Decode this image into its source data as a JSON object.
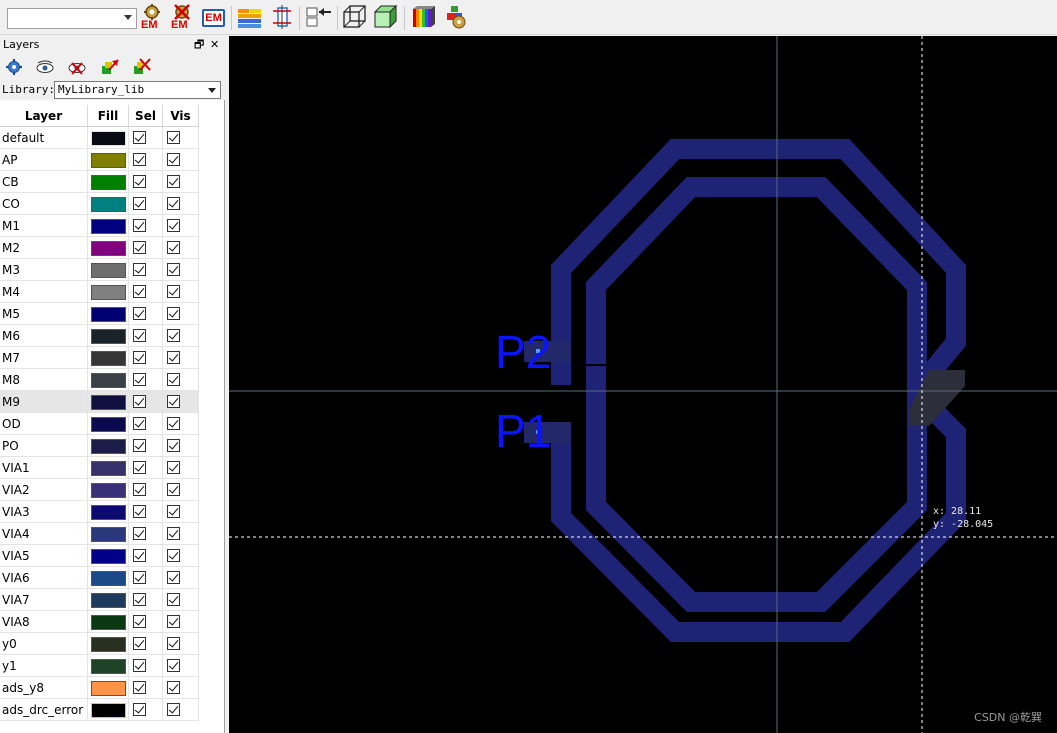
{
  "toolbar": {
    "combo_value": "",
    "buttons": [
      {
        "name": "em-setup-icon",
        "label": "EM"
      },
      {
        "name": "em-clear-icon",
        "label": "EM"
      },
      {
        "name": "em-icon",
        "label": "EM"
      },
      {
        "name": "layer-stack-icon"
      },
      {
        "name": "align-icon"
      },
      {
        "name": "port-arrow-icon"
      },
      {
        "name": "wireframe-view-icon"
      },
      {
        "name": "solid-view-icon"
      },
      {
        "name": "color-map-icon"
      },
      {
        "name": "component-icon"
      }
    ]
  },
  "layers_panel": {
    "title": "Layers",
    "float_glyph": "🗗",
    "close_glyph": "✕",
    "library_label": "Library:",
    "library_value": "MyLibrary_lib",
    "columns": [
      "Layer",
      "Fill",
      "Sel",
      "Vis"
    ],
    "rows": [
      {
        "name": "default",
        "fill": "#0a0a14",
        "border": "#e0e0e0"
      },
      {
        "name": "AP",
        "fill": "#808000"
      },
      {
        "name": "CB",
        "fill": "#008000"
      },
      {
        "name": "CO",
        "fill": "#008080"
      },
      {
        "name": "M1",
        "fill": "#000080"
      },
      {
        "name": "M2",
        "fill": "#800080"
      },
      {
        "name": "M3",
        "fill": "#6e6e6e"
      },
      {
        "name": "M4",
        "fill": "#808080"
      },
      {
        "name": "M5",
        "fill": "#000070"
      },
      {
        "name": "M6",
        "fill": "#1a2428"
      },
      {
        "name": "M7",
        "fill": "#363636"
      },
      {
        "name": "M8",
        "fill": "#3a4048"
      },
      {
        "name": "M9",
        "fill": "#101040",
        "highlight": true
      },
      {
        "name": "OD",
        "fill": "#0a0a50"
      },
      {
        "name": "PO",
        "fill": "#1c1c48"
      },
      {
        "name": "VIA1",
        "fill": "#38306a"
      },
      {
        "name": "VIA2",
        "fill": "#3a3078"
      },
      {
        "name": "VIA3",
        "fill": "#0a0a70"
      },
      {
        "name": "VIA4",
        "fill": "#283878"
      },
      {
        "name": "VIA5",
        "fill": "#000088"
      },
      {
        "name": "VIA6",
        "fill": "#1c4a88"
      },
      {
        "name": "VIA7",
        "fill": "#1e3a5c"
      },
      {
        "name": "VIA8",
        "fill": "#0a3810"
      },
      {
        "name": "y0",
        "fill": "#283020"
      },
      {
        "name": "y1",
        "fill": "#1e4428"
      },
      {
        "name": "ads_y8",
        "fill": "#ff9448"
      },
      {
        "name": "ads_drc_error",
        "fill": "#000000",
        "border": "#e8d000"
      }
    ]
  },
  "canvas": {
    "port_labels": [
      "P2",
      "P1"
    ],
    "coord_x": "x: 28.11",
    "coord_y": "y: -28.045",
    "watermark": "CSDN @乾巽",
    "colors": {
      "background": "#000000",
      "trace": "#1f2375",
      "label": "#0a14ff",
      "crosshair": "#5a6a7a",
      "cursor_line": "#ffffff"
    }
  }
}
